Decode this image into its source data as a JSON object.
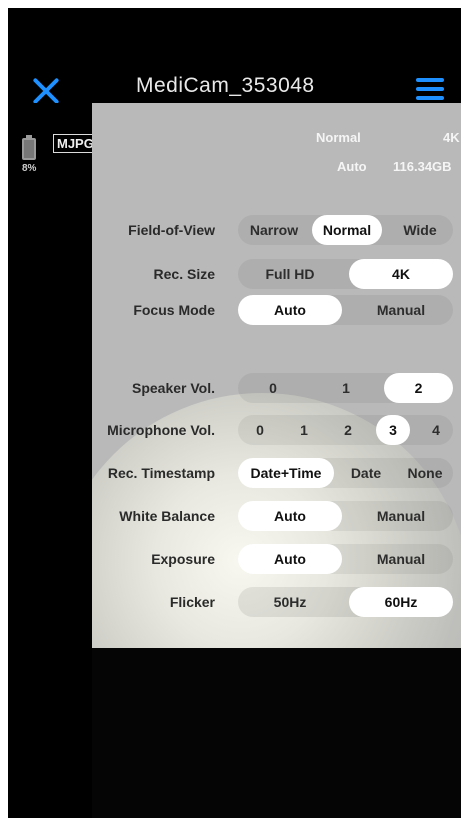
{
  "header": {
    "title": "MediCam_353048"
  },
  "status": {
    "codec": "MJPG",
    "battery": "8%",
    "mode": "Normal",
    "resolution": "4K",
    "focus": "Auto",
    "storage": "116.34GB"
  },
  "settings": {
    "fov": {
      "label": "Field-of-View",
      "options": [
        "Narrow",
        "Normal",
        "Wide"
      ],
      "selected": "Normal"
    },
    "rec_size": {
      "label": "Rec. Size",
      "options": [
        "Full HD",
        "4K"
      ],
      "selected": "4K"
    },
    "focus_mode": {
      "label": "Focus Mode",
      "options": [
        "Auto",
        "Manual"
      ],
      "selected": "Auto"
    },
    "speaker_vol": {
      "label": "Speaker Vol.",
      "options": [
        "0",
        "1",
        "2"
      ],
      "selected": "2"
    },
    "mic_vol": {
      "label": "Microphone Vol.",
      "options": [
        "0",
        "1",
        "2",
        "3",
        "4"
      ],
      "selected": "3"
    },
    "timestamp": {
      "label": "Rec. Timestamp",
      "options": [
        "Date+Time",
        "Date",
        "None"
      ],
      "selected": "Date+Time"
    },
    "white_balance": {
      "label": "White Balance",
      "options": [
        "Auto",
        "Manual"
      ],
      "selected": "Auto"
    },
    "exposure": {
      "label": "Exposure",
      "options": [
        "Auto",
        "Manual"
      ],
      "selected": "Auto"
    },
    "flicker": {
      "label": "Flicker",
      "options": [
        "50Hz",
        "60Hz"
      ],
      "selected": "60Hz"
    }
  },
  "colors": {
    "accent": "#1e90ff",
    "panel": "#b9b9b9"
  },
  "icons": {
    "close": "close-icon",
    "menu": "hamburger-menu-icon",
    "battery": "battery-icon"
  }
}
